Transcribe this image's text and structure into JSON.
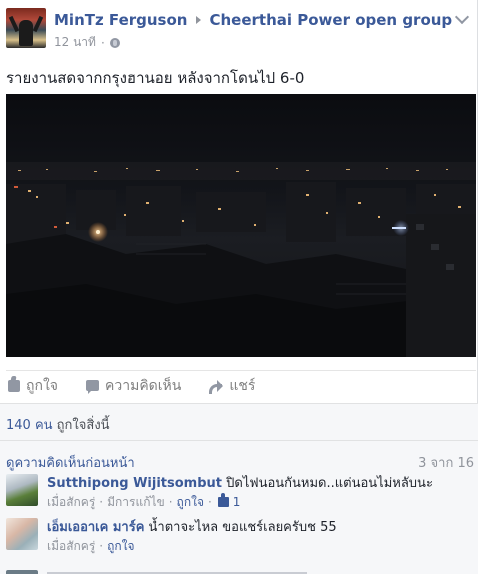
{
  "post": {
    "author": "MinTz Ferguson",
    "group": "Cheerthai Power open group",
    "time": "12 นาที",
    "message": "รายงานสดจากกรุงฮานอย หลังจากโดนไป 6-0"
  },
  "actions": {
    "like": "ถูกใจ",
    "comment": "ความคิดเห็น",
    "share": "แชร์"
  },
  "likes": {
    "count": "140 คน",
    "text": "ถูกใจสิ่งนี้"
  },
  "comments_header": {
    "view_previous": "ดูความคิดเห็นก่อนหน้า",
    "pager": "3 จาก 16"
  },
  "comments": [
    {
      "name": "Sutthipong Wijitsombut",
      "text": "ปิดไฟนอนกันหมด..แต่นอนไม่หลับนะ",
      "time": "เมื่อสักครู่",
      "edited": "มีการแก้ไข",
      "like": "ถูกใจ",
      "like_count": "1"
    },
    {
      "name": "เอ็มเออาเค มาร์ค",
      "text": "น้ำตาจะไหล ขอแชร์เลยครับช 55",
      "time": "เมื่อสักครู่",
      "like": "ถูกใจ"
    }
  ],
  "colors": {
    "link": "#3b5998",
    "meta": "#90949c",
    "ufi_bg": "#f6f7f9"
  }
}
